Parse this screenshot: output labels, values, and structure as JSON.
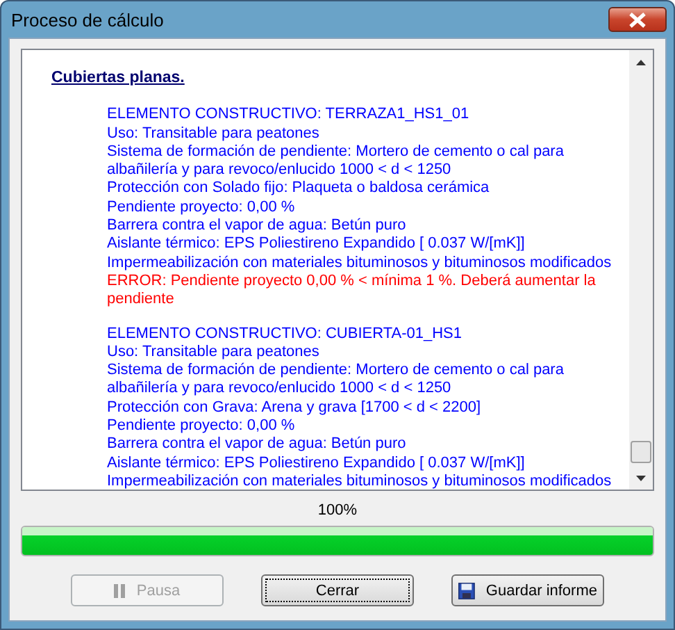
{
  "window": {
    "title": "Proceso de cálculo"
  },
  "report": {
    "heading": "Cubiertas planas.",
    "entries": [
      {
        "lines": [
          {
            "kind": "info",
            "text": "ELEMENTO CONSTRUCTIVO: TERRAZA1_HS1_01"
          },
          {
            "kind": "info",
            "text": "Uso: Transitable para peatones"
          },
          {
            "kind": "info",
            "text": "Sistema de formación de pendiente: Mortero de cemento o cal para albañilería y para revoco/enlucido 1000 < d < 1250"
          },
          {
            "kind": "info",
            "text": "Protección con Solado fijo: Plaqueta o baldosa cerámica"
          },
          {
            "kind": "info",
            "text": "Pendiente proyecto: 0,00 %"
          },
          {
            "kind": "info",
            "text": "Barrera contra el vapor de agua: Betún puro"
          },
          {
            "kind": "info",
            "text": "Aislante térmico: EPS Poliestireno Expandido [ 0.037 W/[mK]]"
          },
          {
            "kind": "info",
            "text": "Impermeabilización con materiales bituminosos y bituminosos modificados"
          },
          {
            "kind": "error",
            "text": "ERROR: Pendiente proyecto 0,00 % < mínima 1 %. Deberá aumentar la pendiente"
          }
        ]
      },
      {
        "lines": [
          {
            "kind": "info",
            "text": "ELEMENTO CONSTRUCTIVO: CUBIERTA-01_HS1"
          },
          {
            "kind": "info",
            "text": "Uso: Transitable para peatones"
          },
          {
            "kind": "info",
            "text": "Sistema de formación de pendiente: Mortero de cemento o cal para albañilería y para revoco/enlucido 1000 < d < 1250"
          },
          {
            "kind": "info",
            "text": "Protección con Grava: Arena y grava [1700 < d < 2200]"
          },
          {
            "kind": "info",
            "text": "Pendiente proyecto: 0,00 %"
          },
          {
            "kind": "info",
            "text": "Barrera contra el vapor de agua: Betún puro"
          },
          {
            "kind": "info",
            "text": "Aislante térmico: EPS Poliestireno Expandido [ 0.037 W/[mK]]"
          },
          {
            "kind": "info",
            "text": "Impermeabilización con materiales bituminosos y bituminosos modificados"
          }
        ]
      }
    ]
  },
  "progress": {
    "label": "100%",
    "level": 1
  },
  "buttons": [
    {
      "label": "Pausa",
      "kind": "pause",
      "disabled": true,
      "focused": false
    },
    {
      "label": "Cerrar",
      "kind": "plain",
      "disabled": false,
      "focused": true
    },
    {
      "label": "Guardar informe",
      "kind": "save",
      "disabled": false,
      "focused": false
    }
  ]
}
